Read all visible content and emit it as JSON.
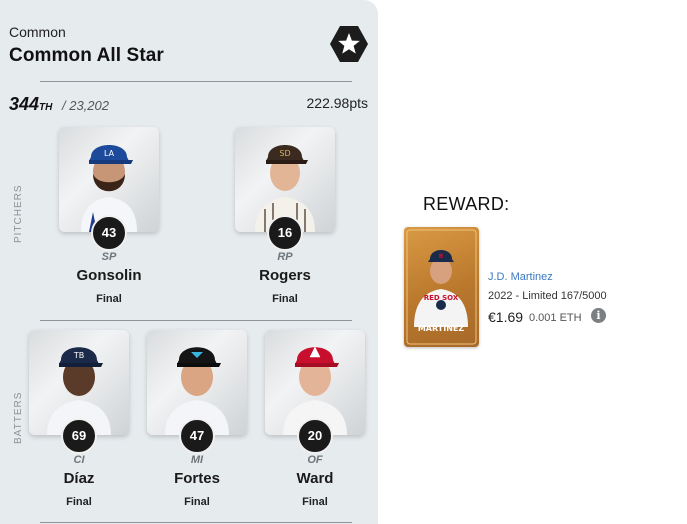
{
  "league": {
    "rarity": "Common",
    "title": "Common All Star",
    "rank": "344",
    "rank_suffix": "TH",
    "rank_total": "/ 23,202",
    "points": "222.98pts"
  },
  "sections": {
    "pitchers_label": "PITCHERS",
    "batters_label": "BATTERS"
  },
  "pitchers": [
    {
      "number": "43",
      "position": "SP",
      "name": "Gonsolin",
      "status": "Final"
    },
    {
      "number": "16",
      "position": "RP",
      "name": "Rogers",
      "status": "Final"
    }
  ],
  "batters": [
    {
      "number": "69",
      "position": "CI",
      "name": "Díaz",
      "status": "Final"
    },
    {
      "number": "47",
      "position": "MI",
      "name": "Fortes",
      "status": "Final"
    },
    {
      "number": "20",
      "position": "OF",
      "name": "Ward",
      "status": "Final"
    }
  ],
  "reward": {
    "label": "REWARD:",
    "card_player_name": "MARTINEZ",
    "player": "J.D. Martinez",
    "edition": "2022 - Limited 167/5000",
    "price": "€1.69",
    "eth": "0.001 ETH",
    "info_icon": "info-icon"
  }
}
